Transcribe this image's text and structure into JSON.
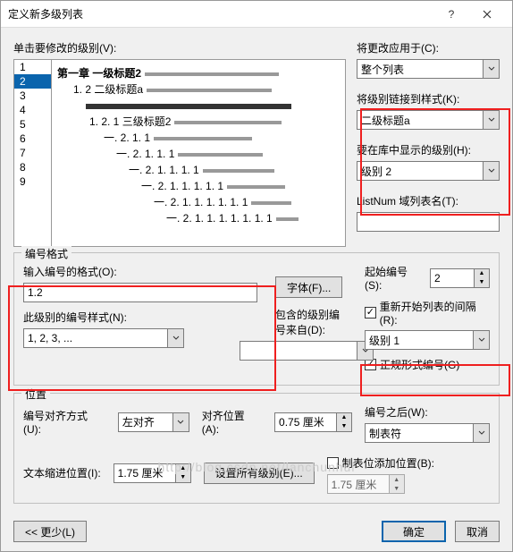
{
  "title": "定义新多级列表",
  "click_level_label": "单击要修改的级别(V):",
  "levels": [
    "1",
    "2",
    "3",
    "4",
    "5",
    "6",
    "7",
    "8",
    "9"
  ],
  "selected_level": "2",
  "preview": {
    "l1": "第一章 一级标题2",
    "l2": "1. 2 二级标题a",
    "l3": "1. 2. 1 三级标题2",
    "l4": "一. 2. 1. 1",
    "l5": "一. 2. 1. 1. 1",
    "l6": "一. 2. 1. 1. 1. 1",
    "l7": "一. 2. 1. 1. 1. 1. 1",
    "l8": "一. 2. 1. 1. 1. 1. 1. 1",
    "l9": "一. 2. 1. 1. 1. 1. 1. 1. 1"
  },
  "apply_to_label": "将更改应用于(C):",
  "apply_to_value": "整个列表",
  "link_style_label": "将级别链接到样式(K):",
  "link_style_value": "二级标题a",
  "gallery_level_label": "要在库中显示的级别(H):",
  "gallery_level_value": "级别 2",
  "listnum_label": "ListNum 域列表名(T):",
  "listnum_value": "",
  "number_format_legend": "编号格式",
  "enter_format_label": "输入编号的格式(O):",
  "enter_format_value": "1.2",
  "font_btn": "字体(F)...",
  "number_style_label": "此级别的编号样式(N):",
  "number_style_value": "1, 2, 3, ...",
  "include_from_label": "包含的级别编号来自(D):",
  "include_from_value": "",
  "start_at_label": "起始编号(S):",
  "start_at_value": "2",
  "restart_label": "重新开始列表的间隔(R):",
  "restart_value": "级别 1",
  "legal_label": "正规形式编号(G)",
  "position_legend": "位置",
  "align_label": "编号对齐方式(U):",
  "align_value": "左对齐",
  "align_at_label": "对齐位置(A):",
  "align_at_value": "0.75 厘米",
  "follow_label": "编号之后(W):",
  "follow_value": "制表符",
  "indent_label": "文本缩进位置(I):",
  "indent_value": "1.75 厘米",
  "set_all_btn": "设置所有级别(E)...",
  "tab_stop_label": "制表位添加位置(B):",
  "tab_stop_value": "1.75 厘米",
  "less_btn": "<< 更少(L)",
  "ok_btn": "确定",
  "cancel_btn": "取消",
  "watermark": "http://blog.csdn.net/lanchunhui"
}
